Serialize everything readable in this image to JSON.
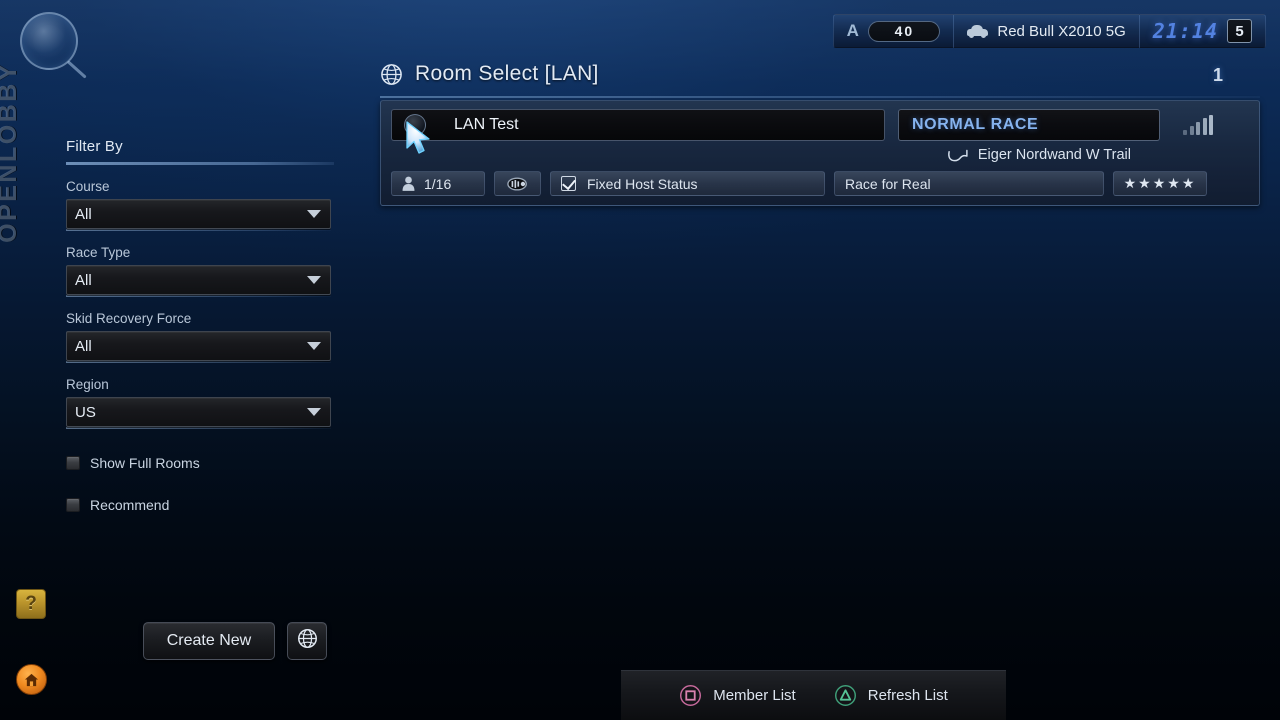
{
  "brand": {
    "vertical_label": "OPENLOBBY",
    "magnifier_icon": "magnifier-icon"
  },
  "hud": {
    "rating_letter": "A",
    "rating_value": "40",
    "car_icon": "car-icon",
    "car_name": "Red Bull X2010 5G",
    "clock": "21:14",
    "day": "5"
  },
  "header": {
    "globe_icon": "globe-icon",
    "title": "Room Select [LAN]",
    "page_number": "1"
  },
  "filter": {
    "title": "Filter By",
    "groups": [
      {
        "label": "Course",
        "value": "All"
      },
      {
        "label": "Race Type",
        "value": "All"
      },
      {
        "label": "Skid Recovery Force",
        "value": "All"
      },
      {
        "label": "Region",
        "value": "US"
      }
    ],
    "checkboxes": [
      {
        "label": "Show Full Rooms",
        "checked": false
      },
      {
        "label": "Recommend",
        "checked": false
      }
    ]
  },
  "rooms": [
    {
      "lock_icon": "lock-icon",
      "name": "LAN Test",
      "race_type": "NORMAL RACE",
      "signal_icon": "signal-bars-icon",
      "track_icon": "track-outline-icon",
      "course": "Eiger Nordwand W Trail",
      "players_icon": "person-icon",
      "players": "1/16",
      "mic_icon": "voice-chat-icon",
      "host_status_label": "Fixed Host Status",
      "host_status_checked": true,
      "tag": "Race for Real",
      "stars": "★★★★★"
    }
  ],
  "actions": {
    "help_label": "?",
    "home_icon": "home-icon",
    "create_new": "Create New",
    "globe_icon": "globe-icon"
  },
  "command_bar": {
    "items": [
      {
        "button_icon": "playstation-square-icon",
        "label": "Member List"
      },
      {
        "button_icon": "playstation-triangle-icon",
        "label": "Refresh List"
      }
    ]
  },
  "cursor": {
    "icon": "arrow-cursor-icon"
  },
  "colors": {
    "bg_top": "#0e2f5f",
    "bg_bottom": "#000308",
    "accent_blue": "#86b3ee",
    "clock_blue": "#4f7fe0",
    "help_gold": "#d8b43e",
    "home_orange": "#f08a20",
    "ps_square_pink": "#d06a9a",
    "ps_triangle_green": "#4fbf8f"
  }
}
